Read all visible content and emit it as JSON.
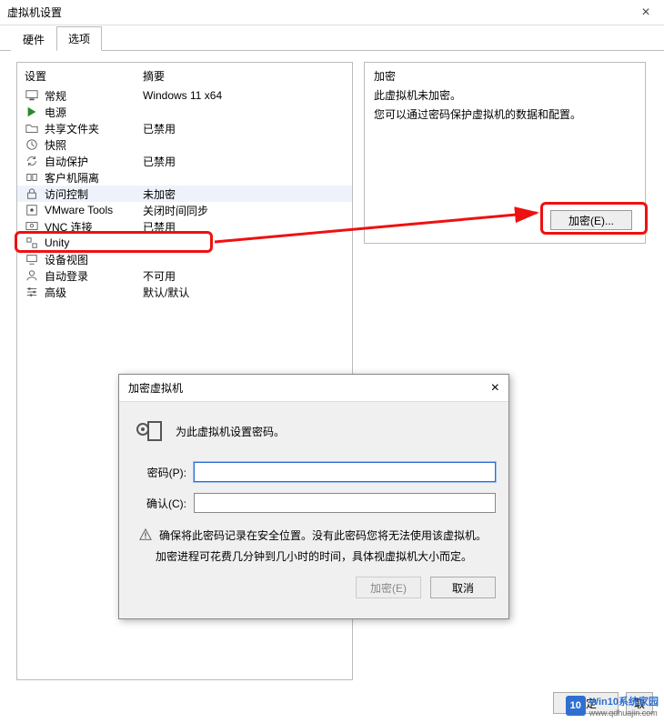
{
  "window": {
    "title": "虚拟机设置",
    "close_glyph": "×"
  },
  "tabs": {
    "hardware": "硬件",
    "options": "选项"
  },
  "columns": {
    "setting": "设置",
    "summary": "摘要"
  },
  "settings": [
    {
      "label": "常规",
      "summary": "Windows 11 x64"
    },
    {
      "label": "电源",
      "summary": ""
    },
    {
      "label": "共享文件夹",
      "summary": "已禁用"
    },
    {
      "label": "快照",
      "summary": ""
    },
    {
      "label": "自动保护",
      "summary": "已禁用"
    },
    {
      "label": "客户机隔离",
      "summary": ""
    },
    {
      "label": "访问控制",
      "summary": "未加密"
    },
    {
      "label": "VMware Tools",
      "summary": "关闭时间同步"
    },
    {
      "label": "VNC 连接",
      "summary": "已禁用"
    },
    {
      "label": "Unity",
      "summary": ""
    },
    {
      "label": "设备视图",
      "summary": ""
    },
    {
      "label": "自动登录",
      "summary": "不可用"
    },
    {
      "label": "高级",
      "summary": "默认/默认"
    }
  ],
  "right": {
    "title": "加密",
    "line1": "此虚拟机未加密。",
    "line2": "您可以通过密码保护虚拟机的数据和配置。",
    "button": "加密(E)..."
  },
  "dialog": {
    "title": "加密虚拟机",
    "close_glyph": "×",
    "heading": "为此虚拟机设置密码。",
    "password_label": "密码(P):",
    "confirm_label": "确认(C):",
    "warning": "确保将此密码记录在安全位置。没有此密码您将无法使用该虚拟机。",
    "note": "加密进程可花费几分钟到几小时的时间，具体视虚拟机大小而定。",
    "encrypt_btn": "加密(E)",
    "cancel_btn": "取消"
  },
  "buttons": {
    "ok": "确定",
    "cancel": "取"
  },
  "watermark": {
    "logo": "10",
    "title": "Win10系统家园",
    "url": "www.qdhuajin.com"
  }
}
